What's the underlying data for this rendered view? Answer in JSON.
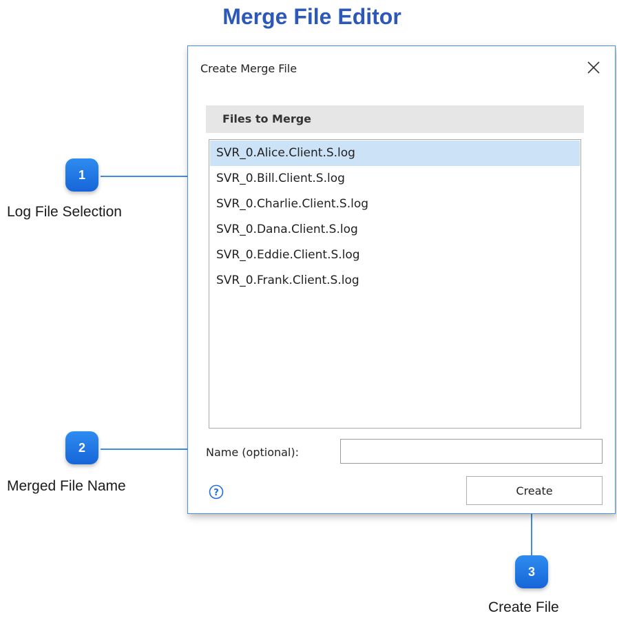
{
  "page": {
    "title": "Merge File Editor"
  },
  "dialog": {
    "title": "Create Merge File",
    "files_header": "Files to Merge",
    "files": [
      "SVR_0.Alice.Client.S.log",
      "SVR_0.Bill.Client.S.log",
      "SVR_0.Charlie.Client.S.log",
      "SVR_0.Dana.Client.S.log",
      "SVR_0.Eddie.Client.S.log",
      "SVR_0.Frank.Client.S.log"
    ],
    "selected_file_index": 0,
    "name_label": "Name (optional):",
    "name_value": "",
    "create_label": "Create",
    "icons": [
      "close-icon",
      "help-icon"
    ],
    "accent_color": "#4a8ee0",
    "selection_color": "#cce3f7"
  },
  "callouts": [
    {
      "number": "1",
      "label": "Log File Selection"
    },
    {
      "number": "2",
      "label": "Merged File Name"
    },
    {
      "number": "3",
      "label": "Create File"
    }
  ],
  "colors": {
    "title": "#2c58b8",
    "callout_badge": "#1f78e6",
    "callout_line": "#3f8de0"
  }
}
